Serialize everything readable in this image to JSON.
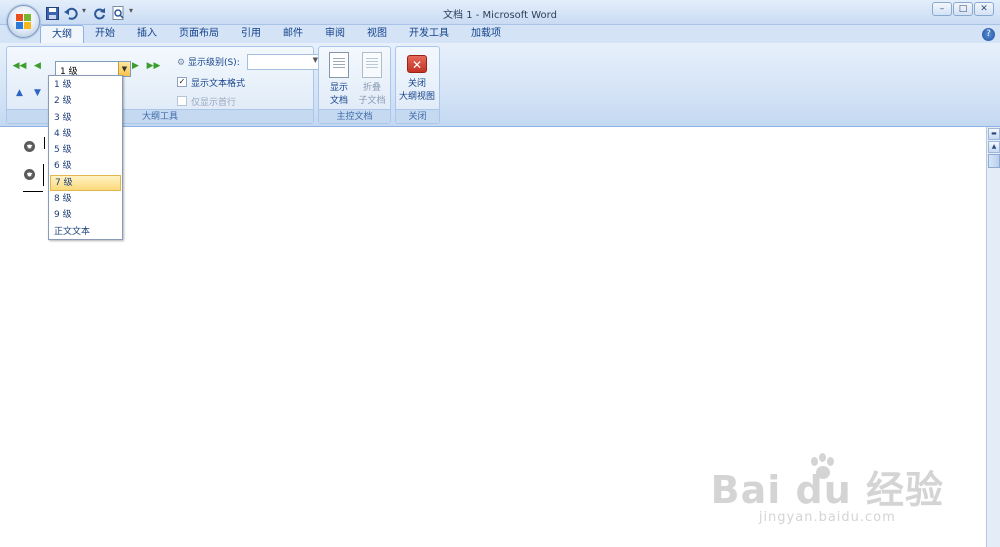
{
  "window": {
    "title": "文档 1 - Microsoft Word",
    "controls": [
      "–",
      "□",
      "✕"
    ]
  },
  "qat": {
    "save_icon": "save-icon",
    "undo_icon": "undo-icon",
    "redo_icon": "repeat-icon",
    "preview_icon": "print-preview-icon",
    "customize_glyph": "▾"
  },
  "tabs": [
    {
      "label": "大纲",
      "active": true
    },
    {
      "label": "开始"
    },
    {
      "label": "插入"
    },
    {
      "label": "页面布局"
    },
    {
      "label": "引用"
    },
    {
      "label": "邮件"
    },
    {
      "label": "审阅"
    },
    {
      "label": "视图"
    },
    {
      "label": "开发工具"
    },
    {
      "label": "加载项"
    }
  ],
  "help": "?",
  "outline_tools": {
    "group_label": "大纲工具",
    "level_value": "1 级",
    "show_level_label": "显示级别(S):",
    "show_level_value": "",
    "show_text_format": {
      "label": "显示文本格式",
      "checked": true
    },
    "show_first_line": {
      "label": "仅显示首行",
      "checked": false
    }
  },
  "master_doc": {
    "group_label": "主控文档",
    "show_document": {
      "line1": "显示",
      "line2": "文档"
    },
    "collapse_subdocs": {
      "line1": "折叠",
      "line2": "子文档"
    }
  },
  "close_group": {
    "group_label": "关闭",
    "close_outline": {
      "line1": "关闭",
      "line2": "大纲视图"
    }
  },
  "level_dropdown": {
    "items": [
      "1 级",
      "2 级",
      "3 级",
      "4 级",
      "5 级",
      "6 级",
      "7 级",
      "8 级",
      "9 级",
      "正文文本"
    ],
    "highlighted_index": 6
  },
  "document": {
    "bullet_glyph": "−"
  },
  "watermark": {
    "brand": "Bai du 经验",
    "url": "jingyan.baidu.com"
  },
  "colors": {
    "ribbon_text": "#15428b",
    "highlight": "#fbd97a",
    "close_red": "#c23224"
  }
}
